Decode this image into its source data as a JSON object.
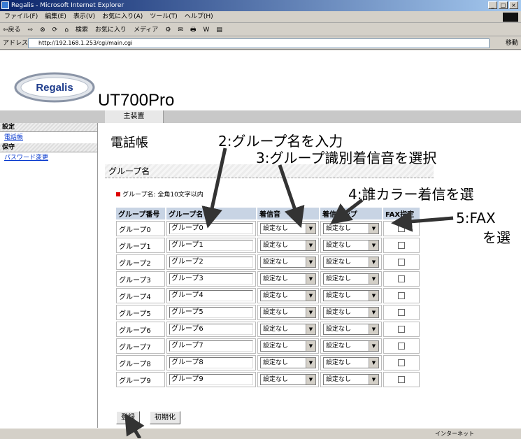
{
  "window": {
    "title": "Regalis - Microsoft Internet Explorer",
    "controls": [
      "_",
      "□",
      "×"
    ]
  },
  "menu": [
    "ファイル(F)",
    "編集(E)",
    "表示(V)",
    "お気に入り(A)",
    "ツール(T)",
    "ヘルプ(H)"
  ],
  "toolbar": [
    "⇦戻る",
    "⇨",
    "⊗",
    "⟳",
    "⌂",
    "検索",
    "お気に入り",
    "メディア",
    "⚙",
    "✉",
    "🖶",
    "W",
    "▤"
  ],
  "address": {
    "label": "アドレス(D)",
    "url": "http://192.168.1.253/cgi/main.cgi",
    "go": "移動"
  },
  "logo": "Regalis",
  "product": "UT700Pro",
  "nav_tab": "主装置",
  "sidebar": [
    {
      "section": "設定",
      "links": [
        "電話帳"
      ]
    },
    {
      "section": "保守",
      "links": [
        "パスワード変更"
      ]
    }
  ],
  "page_title": "電話帳",
  "section_title": "グループ名",
  "note": "グループ名: 全角10文字以内",
  "table": {
    "headers": [
      "グループ番号",
      "グループ名",
      "着信音",
      "着信ランプ",
      "FAX指定"
    ],
    "rows": [
      {
        "no": "グループ0",
        "name": "グループ0",
        "ring": "設定なし",
        "lamp": "設定なし"
      },
      {
        "no": "グループ1",
        "name": "グループ1",
        "ring": "設定なし",
        "lamp": "設定なし"
      },
      {
        "no": "グループ2",
        "name": "グループ2",
        "ring": "設定なし",
        "lamp": "設定なし"
      },
      {
        "no": "グループ3",
        "name": "グループ3",
        "ring": "設定なし",
        "lamp": "設定なし"
      },
      {
        "no": "グループ4",
        "name": "グループ4",
        "ring": "設定なし",
        "lamp": "設定なし"
      },
      {
        "no": "グループ5",
        "name": "グループ5",
        "ring": "設定なし",
        "lamp": "設定なし"
      },
      {
        "no": "グループ6",
        "name": "グループ6",
        "ring": "設定なし",
        "lamp": "設定なし"
      },
      {
        "no": "グループ7",
        "name": "グループ7",
        "ring": "設定なし",
        "lamp": "設定なし"
      },
      {
        "no": "グループ8",
        "name": "グループ8",
        "ring": "設定なし",
        "lamp": "設定なし"
      },
      {
        "no": "グループ9",
        "name": "グループ9",
        "ring": "設定なし",
        "lamp": "設定なし"
      }
    ]
  },
  "buttons": {
    "register": "登録",
    "reset": "初期化"
  },
  "status": {
    "zone": "インターネット"
  },
  "annotations": {
    "a2": "2:グループ名を入力",
    "a3": "3:グループ識別着信音を選択",
    "a4": "4:誰カラー着信を選",
    "a5a": "5:FAX",
    "a5b": "を選"
  }
}
